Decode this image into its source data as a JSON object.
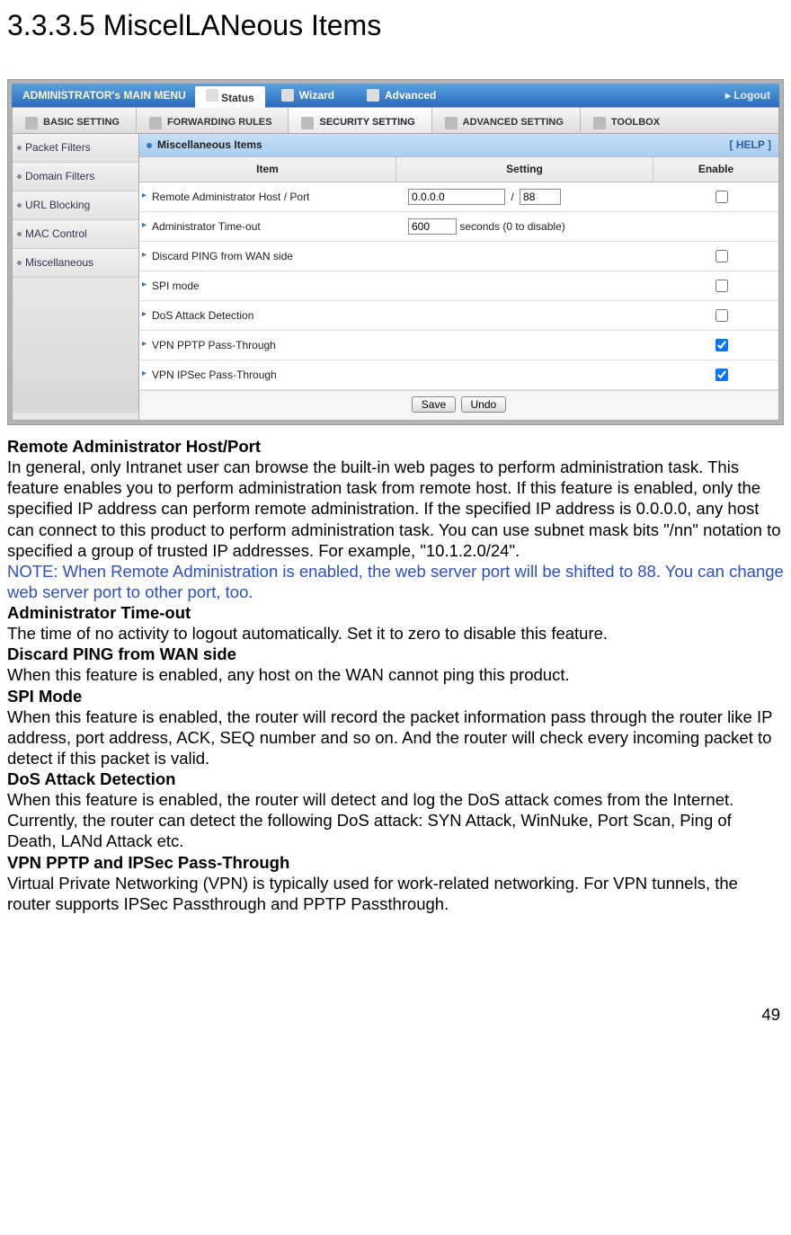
{
  "page": {
    "heading": "3.3.3.5 MiscelLANeous Items",
    "page_number": "49"
  },
  "router_ui": {
    "topbar": {
      "menu_title": "ADMINISTRATOR's MAIN MENU",
      "status": "Status",
      "wizard": "Wizard",
      "advanced": "Advanced",
      "logout": "Logout"
    },
    "subnav": {
      "basic": "BASIC SETTING",
      "forwarding": "FORWARDING RULES",
      "security": "SECURITY SETTING",
      "adv": "ADVANCED SETTING",
      "toolbox": "TOOLBOX"
    },
    "sidebar": {
      "items": [
        {
          "label": "Packet Filters"
        },
        {
          "label": "Domain Filters"
        },
        {
          "label": "URL Blocking"
        },
        {
          "label": "MAC Control"
        },
        {
          "label": "Miscellaneous"
        }
      ]
    },
    "panel": {
      "title": "Miscellaneous Items",
      "help": "[ HELP ]",
      "columns": {
        "item": "Item",
        "setting": "Setting",
        "enable": "Enable"
      },
      "remote_host": {
        "label": "Remote Administrator Host / Port",
        "ip": "0.0.0.0",
        "sep": "/",
        "port": "88",
        "enabled": false
      },
      "timeout": {
        "label": "Administrator Time-out",
        "value": "600",
        "suffix": "seconds (0 to disable)"
      },
      "rows": [
        {
          "label": "Discard PING from WAN side",
          "checked": false
        },
        {
          "label": "SPI mode",
          "checked": false
        },
        {
          "label": "DoS Attack Detection",
          "checked": false
        },
        {
          "label": "VPN PPTP Pass-Through",
          "checked": true
        },
        {
          "label": "VPN IPSec Pass-Through",
          "checked": true
        }
      ],
      "buttons": {
        "save": "Save",
        "undo": "Undo"
      }
    }
  },
  "explain": {
    "h1": "Remote Administrator Host/Port",
    "p1": "In general, only Intranet user can browse the built-in web pages to perform administration task. This feature enables you to perform administration task from remote host. If this feature is enabled, only the specified IP address can perform remote administration. If the specified IP address is 0.0.0.0, any host can connect to this product to perform administration task. You can use subnet mask bits \"/nn\" notation to specified a group of trusted IP addresses. For example, \"10.1.2.0/24\".",
    "note": "NOTE: When Remote Administration is enabled, the web server port will be shifted to 88. You can change web server port to other port, too.",
    "h2": "Administrator Time-out",
    "p2": "The time of no activity to logout automatically. Set it to zero to disable this feature.",
    "h3": "Discard PING from WAN side",
    "p3": "When this feature is enabled, any host on the WAN cannot ping this product.",
    "h4": "SPI Mode",
    "p4": "When this feature is enabled, the router will record the packet information pass through the router like IP address, port address, ACK, SEQ number and so on. And the router will check every incoming packet to detect if this packet is valid.",
    "h5": "DoS Attack Detection",
    "p5": "When this feature is enabled, the router will detect and log the DoS attack comes from the Internet. Currently, the router can detect the following DoS attack: SYN Attack, WinNuke, Port Scan, Ping of Death, LANd Attack etc.",
    "h6": "VPN PPTP and IPSec Pass-Through",
    "p6": "Virtual Private Networking (VPN) is typically used for work-related networking. For VPN tunnels, the router supports IPSec Passthrough and PPTP Passthrough."
  }
}
